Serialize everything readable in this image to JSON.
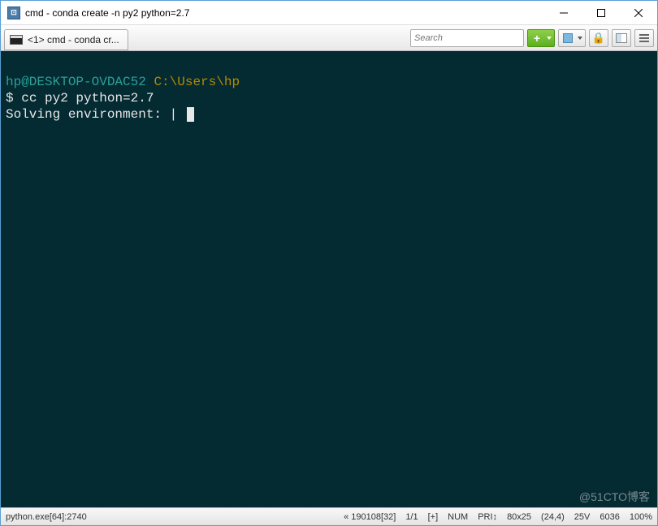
{
  "title": "cmd - conda  create -n py2 python=2.7",
  "tab": {
    "label": "<1> cmd - conda  cr..."
  },
  "search": {
    "placeholder": "Search"
  },
  "terminal": {
    "user": "hp@DESKTOP-OVDAC52",
    "path": "C:\\Users\\hp",
    "prompt": "$",
    "command": "cc py2 python=2.7",
    "output": "Solving environment: |"
  },
  "status": {
    "process": "python.exe[64]:2740",
    "date": "« 190108[32]",
    "pages": "1/1",
    "insert": "[+]",
    "num": "NUM",
    "pri": "PRI↕",
    "size": "80x25",
    "pos": "(24,4)",
    "volt": "25V",
    "count": "6036",
    "zoom": "100%"
  },
  "watermark": "@51CTO博客"
}
